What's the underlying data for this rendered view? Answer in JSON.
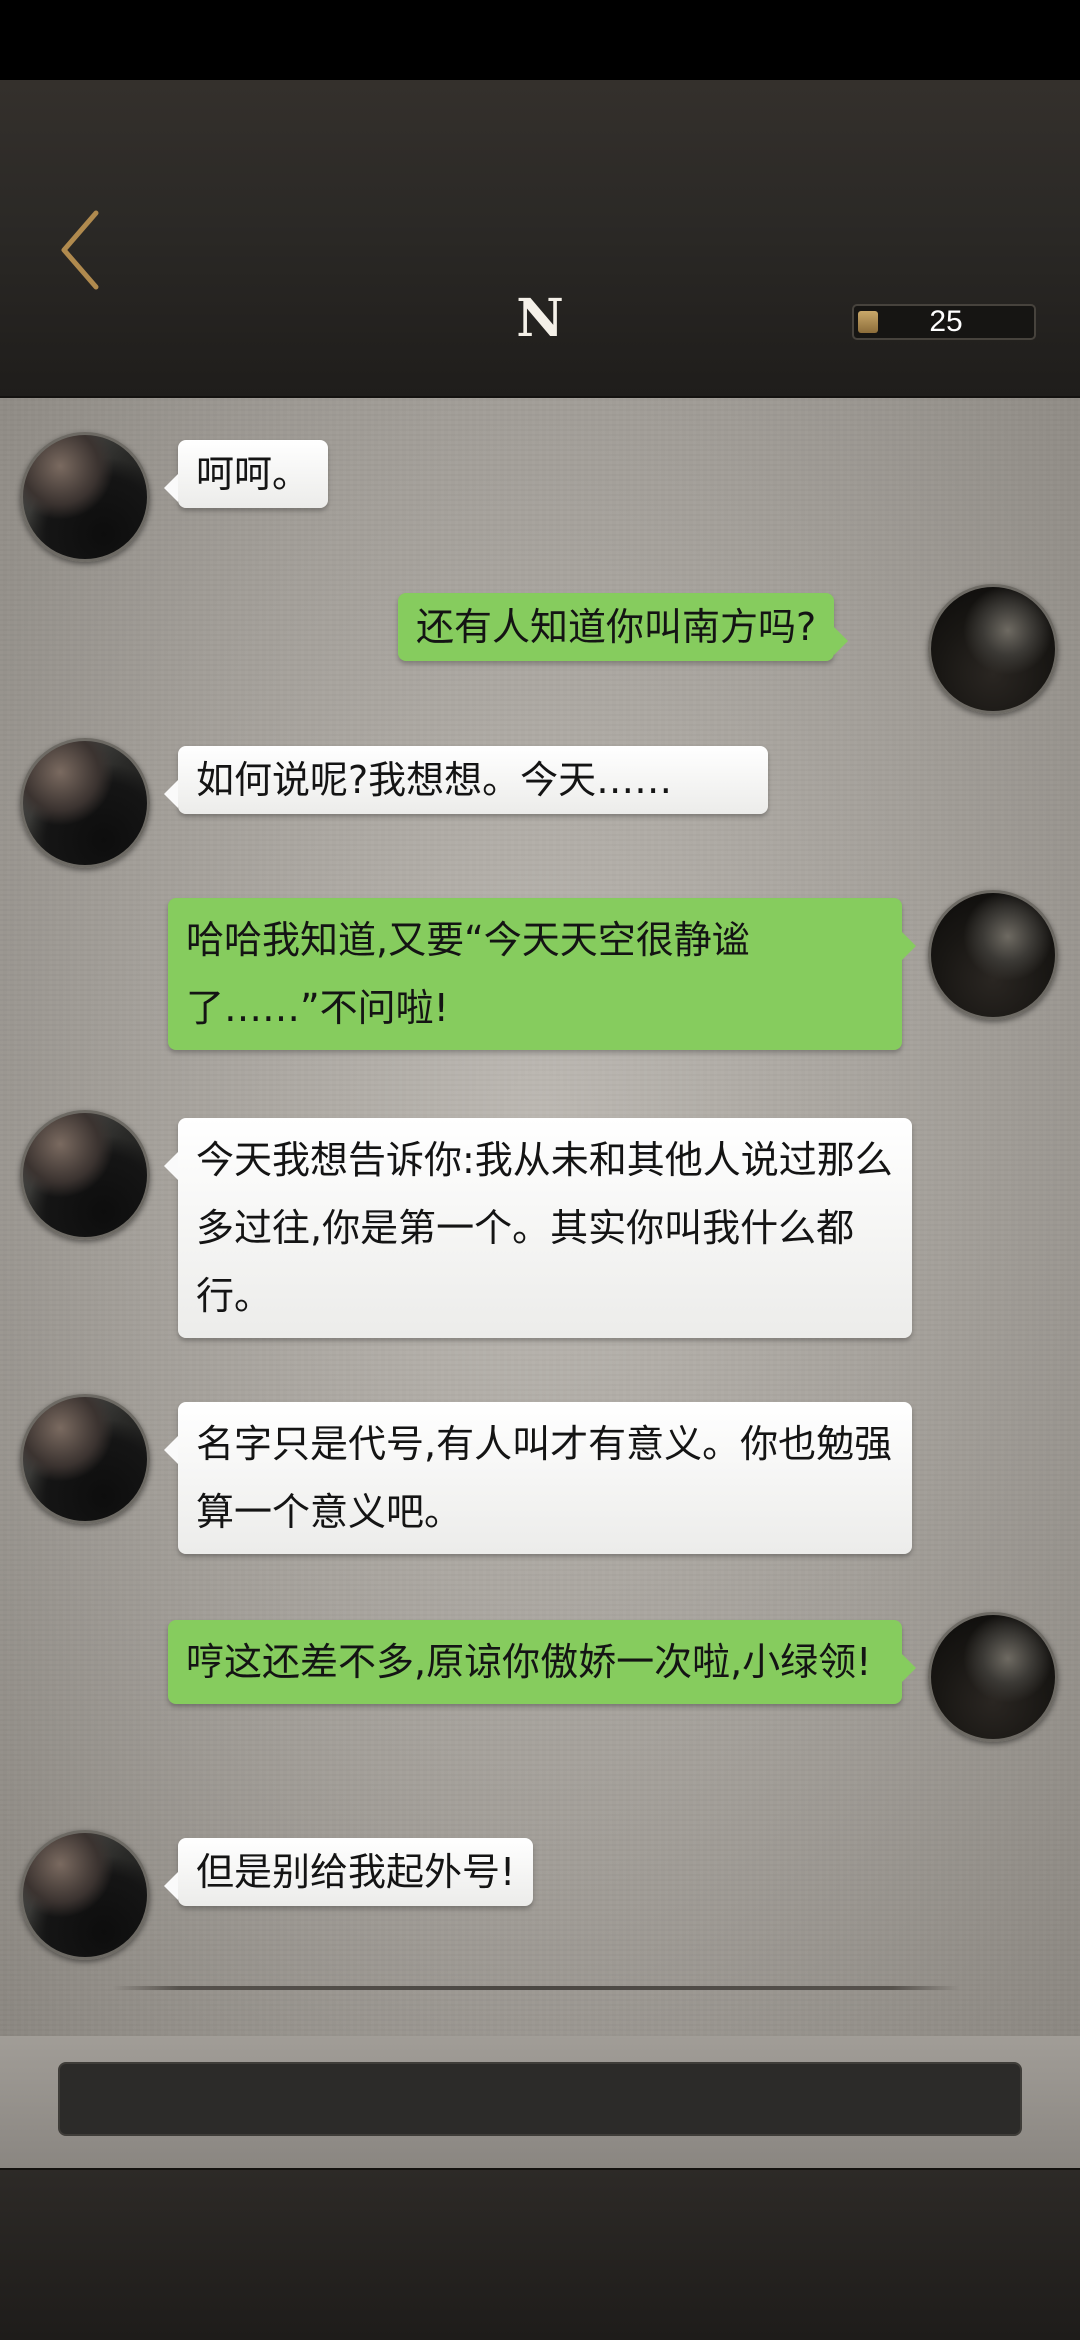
{
  "header": {
    "back_icon": "chevron-left-icon",
    "title": "N",
    "energy_value": "25",
    "accent_color": "#c9a86a"
  },
  "messages": [
    {
      "sender": "other",
      "text": "呵呵。"
    },
    {
      "sender": "self",
      "text": "还有人知道你叫南方吗?"
    },
    {
      "sender": "other",
      "text": "如何说呢?我想想。今天……"
    },
    {
      "sender": "self",
      "text": "哈哈我知道,又要“今天天空很静谧了……”不问啦!"
    },
    {
      "sender": "other",
      "text": "今天我想告诉你:我从未和其他人说过那么多过往,你是第一个。其实你叫我什么都行。"
    },
    {
      "sender": "other",
      "text": "名字只是代号,有人叫才有意义。你也勉强算一个意义吧。"
    },
    {
      "sender": "self",
      "text": "哼这还差不多,原谅你傲娇一次啦,小绿领!"
    },
    {
      "sender": "other",
      "text": "但是别给我起外号!"
    }
  ],
  "colors": {
    "self_bubble": "#86cc5e",
    "other_bubble": "#ffffff",
    "header_bg": "#2b2926"
  }
}
